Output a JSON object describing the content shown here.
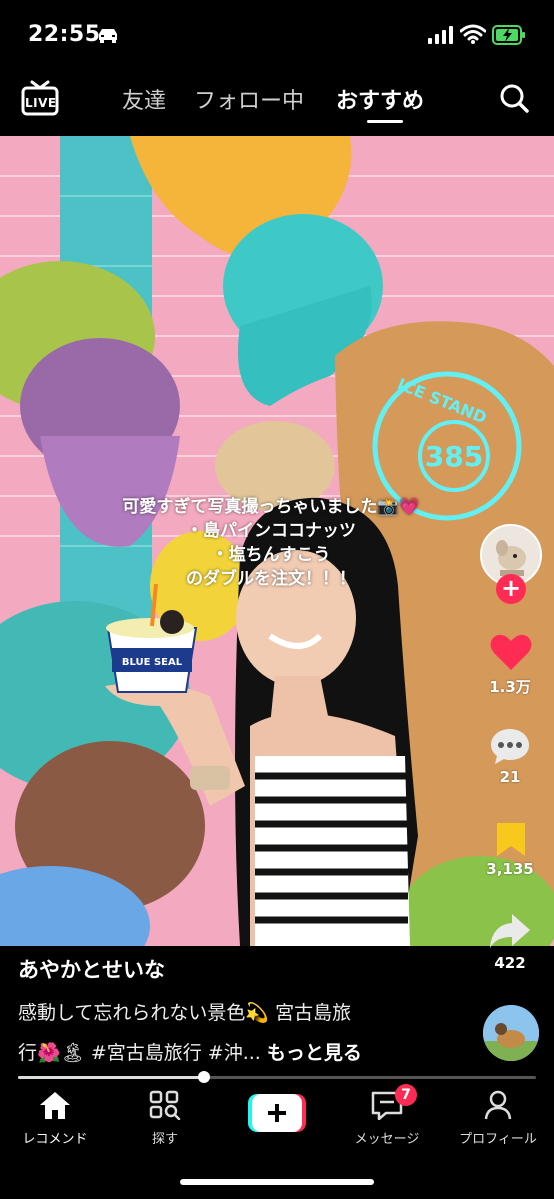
{
  "status_bar": {
    "time": "22:55"
  },
  "top_nav": {
    "live_label": "LIVE",
    "tabs": [
      {
        "label": "友達"
      },
      {
        "label": "フォロー中"
      },
      {
        "label": "おすすめ",
        "active": true
      }
    ]
  },
  "video": {
    "overlay_lines": [
      "可愛すぎて写真撮っちゃいました📸💗",
      "・島パインココナッツ",
      "・塩ちんすこう",
      "のダブルを注文！！！"
    ],
    "sign_text": [
      "ICE STAND",
      "385"
    ],
    "cup_label": "BLUE SEAL"
  },
  "actions": {
    "likes": "1.3万",
    "comments": "21",
    "saves": "3,135",
    "shares": "422"
  },
  "post": {
    "username": "あやかとせいな",
    "caption_line1": "感動して忘れられない景色💫 宮古島旅",
    "caption_line2": "行🌺🏝 #宮古島旅行 #沖...",
    "more_label": "もっと見る",
    "progress": 0.36
  },
  "bottom_nav": {
    "items": [
      {
        "label": "レコメンド"
      },
      {
        "label": "探す"
      },
      {
        "label": ""
      },
      {
        "label": "メッセージ"
      },
      {
        "label": "プロフィール"
      }
    ],
    "inbox_badge": "7"
  },
  "colors": {
    "accent": "#fe2c55",
    "teal": "#25f4ee",
    "bookmark": "#f8c81c"
  }
}
